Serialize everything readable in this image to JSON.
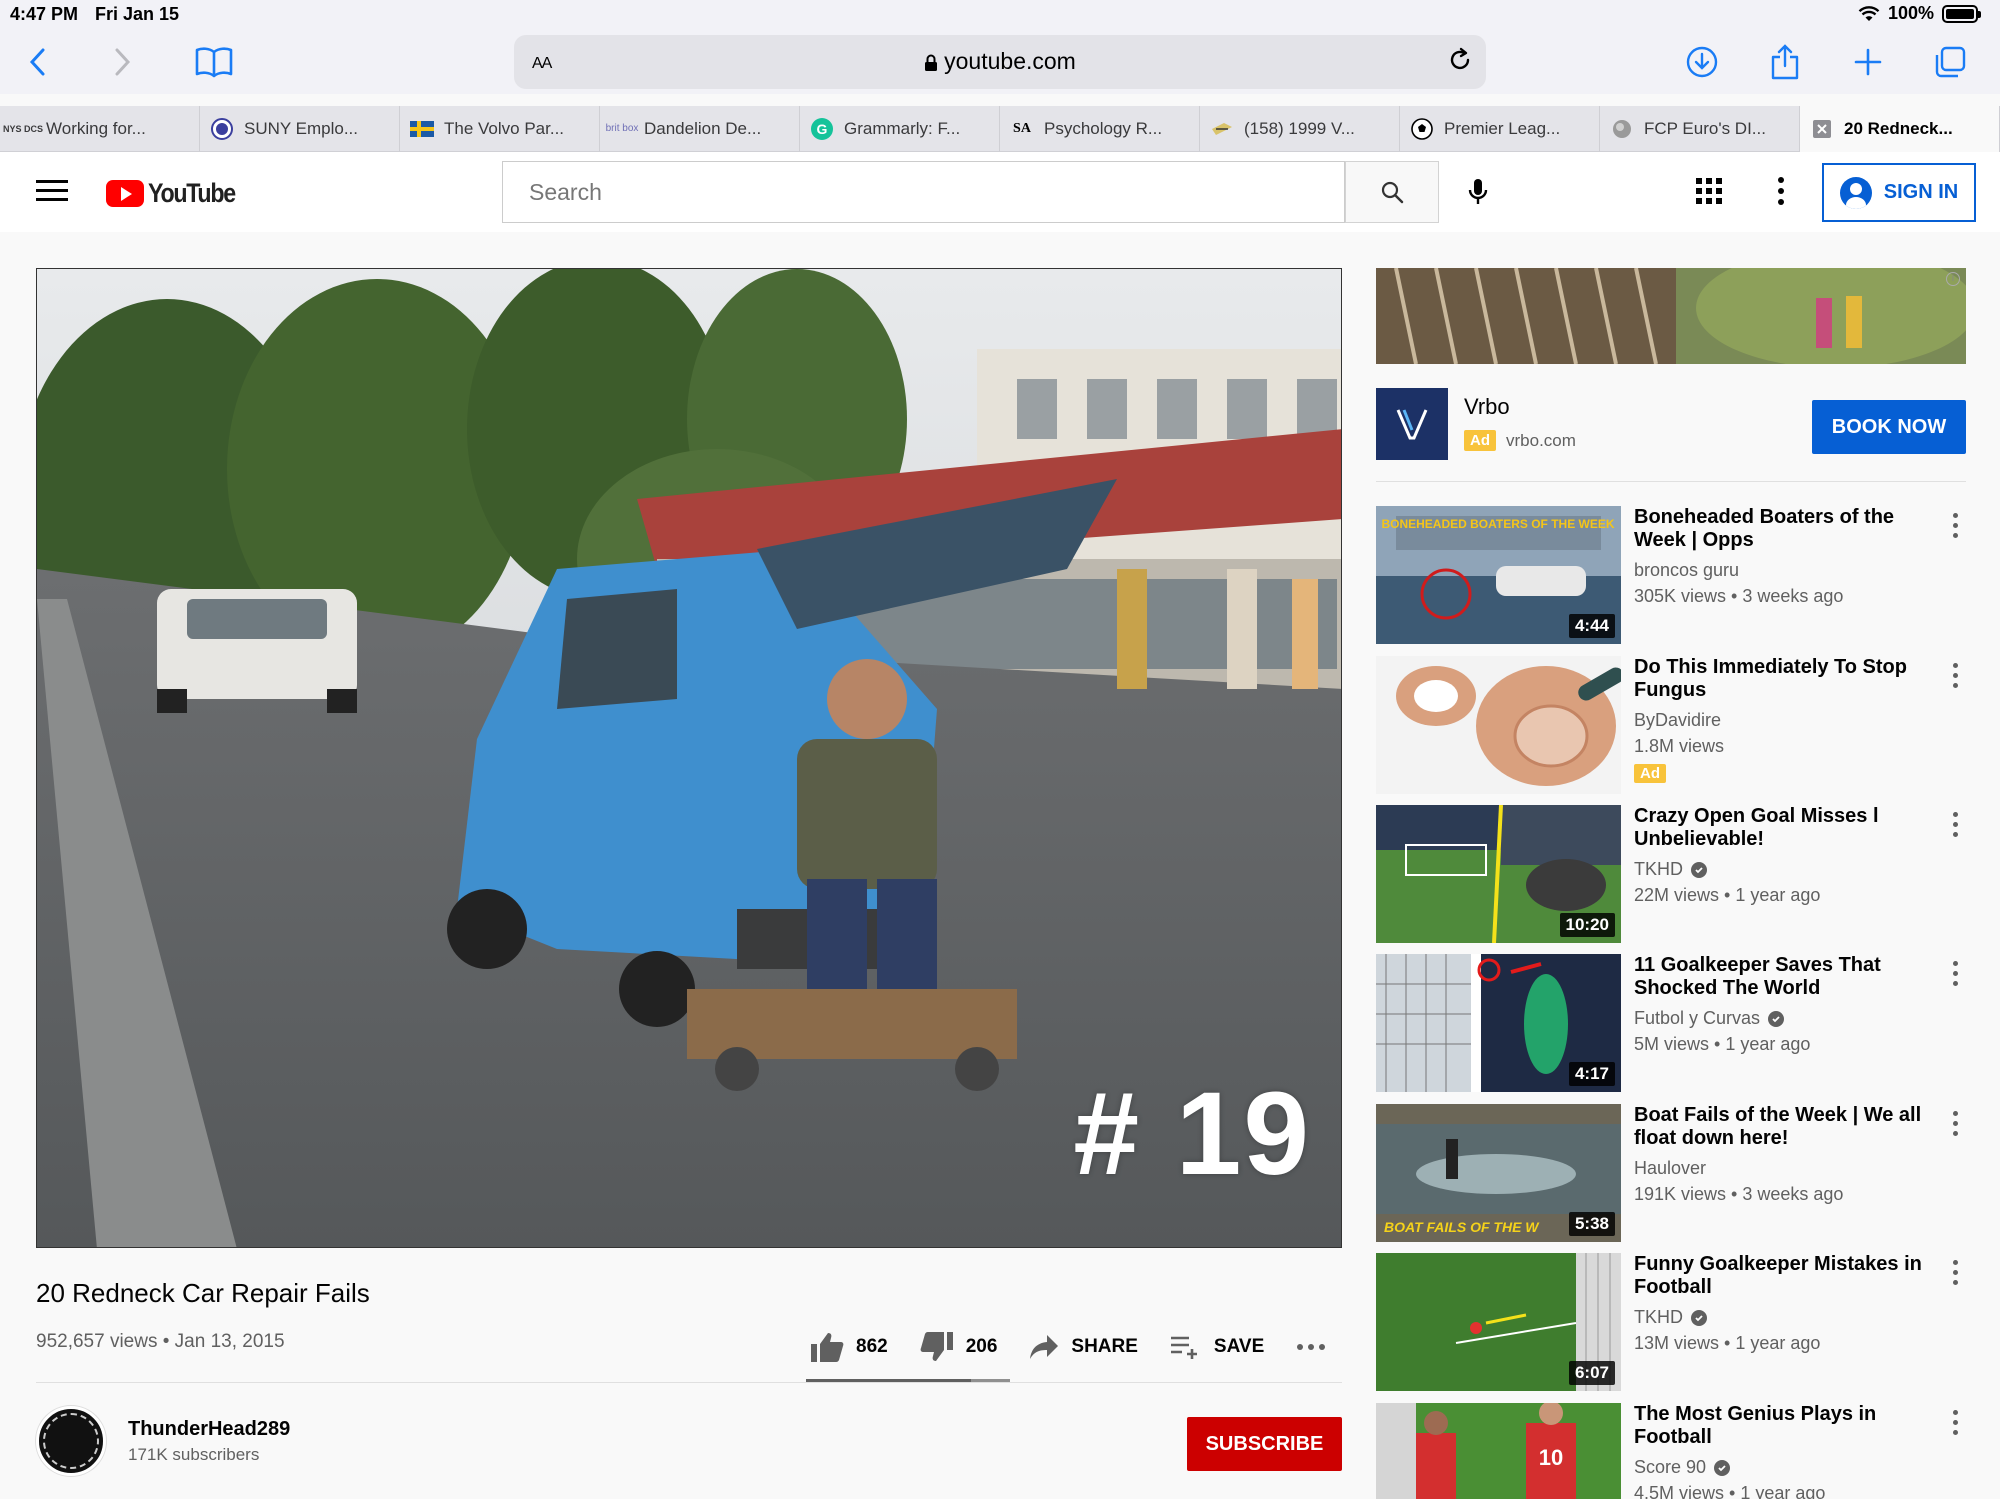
{
  "status_bar": {
    "time": "4:47 PM",
    "date": "Fri Jan 15",
    "battery": "100%",
    "battery_level": 1.0
  },
  "browser": {
    "aa_label": "AA",
    "host": "youtube.com",
    "tabs": [
      {
        "label": "Working for...",
        "favicon": "NYS DCS"
      },
      {
        "label": "SUNY Emplo...",
        "favicon": "SUNY"
      },
      {
        "label": "The Volvo Par...",
        "favicon": "swedish-flag"
      },
      {
        "label": "Dandelion De...",
        "favicon": "brit box"
      },
      {
        "label": "Grammarly: F...",
        "favicon": "G"
      },
      {
        "label": "Psychology R...",
        "favicon": "SA"
      },
      {
        "label": "(158) 1999 V...",
        "favicon": "bird"
      },
      {
        "label": "Premier Leag...",
        "favicon": "soccer-ball"
      },
      {
        "label": "FCP Euro's DI...",
        "favicon": "fcp"
      },
      {
        "label": "20 Redneck...",
        "favicon": "close"
      }
    ]
  },
  "youtube": {
    "logo_text": "YouTube",
    "search_placeholder": "Search",
    "sign_in": "SIGN IN"
  },
  "video": {
    "overlay_text": "# 19",
    "title": "20 Redneck Car Repair Fails",
    "views_date": "952,657 views • Jan 13, 2015",
    "likes": "862",
    "dislikes": "206",
    "share": "SHARE",
    "save": "SAVE",
    "like_ratio": 0.807
  },
  "channel": {
    "name": "ThunderHead289",
    "subscribers": "171K subscribers",
    "subscribe": "SUBSCRIBE"
  },
  "ad": {
    "name": "Vrbo",
    "badge": "Ad",
    "domain": "vrbo.com",
    "cta": "BOOK NOW",
    "info_icon": "i"
  },
  "related": [
    {
      "title": "Boneheaded Boaters of the Week | Opps",
      "channel": "broncos guru",
      "meta": "305K views • 3 weeks ago",
      "duration": "4:44",
      "verified": false,
      "ad": false,
      "thumb_text": "BONEHEADED BOATERS OF THE WEEK"
    },
    {
      "title": "Do This Immediately To Stop Fungus",
      "channel": "ByDavidire",
      "meta": "1.8M views",
      "duration": "",
      "verified": false,
      "ad": true,
      "ad_label": "Ad"
    },
    {
      "title": "Crazy Open Goal Misses l Unbelievable!",
      "channel": "TKHD",
      "meta": "22M views • 1 year ago",
      "duration": "10:20",
      "verified": true,
      "ad": false
    },
    {
      "title": "11 Goalkeeper Saves That Shocked The World",
      "channel": "Futbol y Curvas",
      "meta": "5M views • 1 year ago",
      "duration": "4:17",
      "verified": true,
      "ad": false
    },
    {
      "title": "Boat Fails of the Week | We all float down here!",
      "channel": "Haulover",
      "meta": "191K views • 3 weeks ago",
      "duration": "5:38",
      "verified": false,
      "ad": false,
      "thumb_text": "BOAT FAILS OF THE W"
    },
    {
      "title": "Funny Goalkeeper Mistakes in Football",
      "channel": "TKHD",
      "meta": "13M views • 1 year ago",
      "duration": "6:07",
      "verified": true,
      "ad": false
    },
    {
      "title": "The Most Genius Plays in Football",
      "channel": "Score 90",
      "meta": "4.5M views • 1 year ago",
      "duration": "",
      "verified": true,
      "ad": false,
      "thumb_text": "10"
    }
  ]
}
